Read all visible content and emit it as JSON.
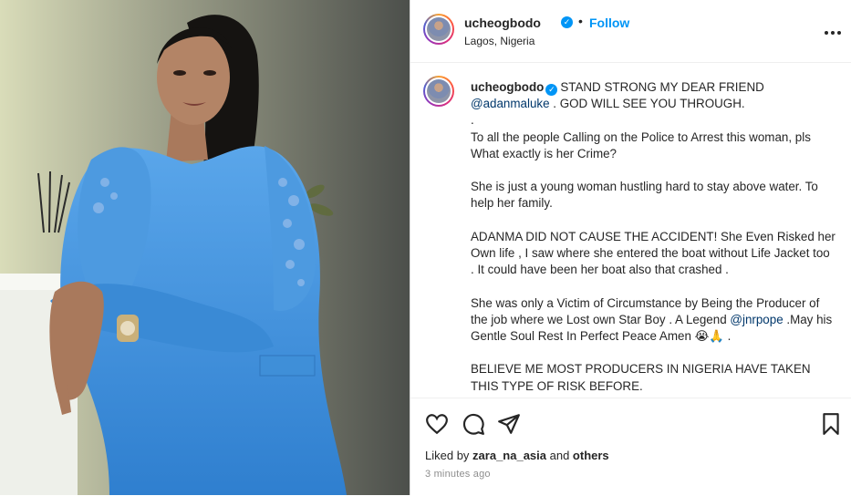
{
  "post": {
    "photo_alt": "",
    "header": {
      "username": "ucheogbodo",
      "separator": "•",
      "follow_label": "Follow",
      "location": "Lagos, Nigeria",
      "more_label": "..."
    },
    "caption": {
      "username": "ucheogbodo",
      "line1_text": "STAND STRONG MY DEAR FRIEND",
      "mention1": "@adanmaluke",
      "line2_text": " . GOD WILL SEE YOU THROUGH.",
      "para_dot": ".",
      "para1": "To all the people Calling on the Police to Arrest this woman, pls What exactly is her Crime?",
      "para2": "She is just a young woman hustling hard to stay above water. To help her family.",
      "para3": "ADANMA DID NOT CAUSE THE ACCIDENT! She Even Risked her Own life , I saw where she entered the boat without Life Jacket too . It could have been her boat also that crashed .",
      "para4_a": "She was only a Victim of Circumstance by Being the Producer of the job where we Lost own Star Boy . A Legend ",
      "mention2": "@jnrpope",
      "para4_b": " .May his Gentle Soul Rest In Perfect Peace Amen 😭🙏 .",
      "para5": "BELIEVE ME MOST PRODUCERS IN NIGERIA HAVE TAKEN THIS TYPE OF RISK BEFORE."
    },
    "actions": {
      "icons": [
        "heart-icon",
        "comment-icon",
        "share-icon",
        "bookmark-icon"
      ]
    },
    "likes": {
      "prefix": "Liked by ",
      "user": "zara_na_asia",
      "middle": " and ",
      "others": "others"
    },
    "timestamp": "3 minutes ago"
  },
  "colors": {
    "accent": "#0095f6",
    "mention": "#00376b",
    "dress": "#3d8fd6"
  }
}
